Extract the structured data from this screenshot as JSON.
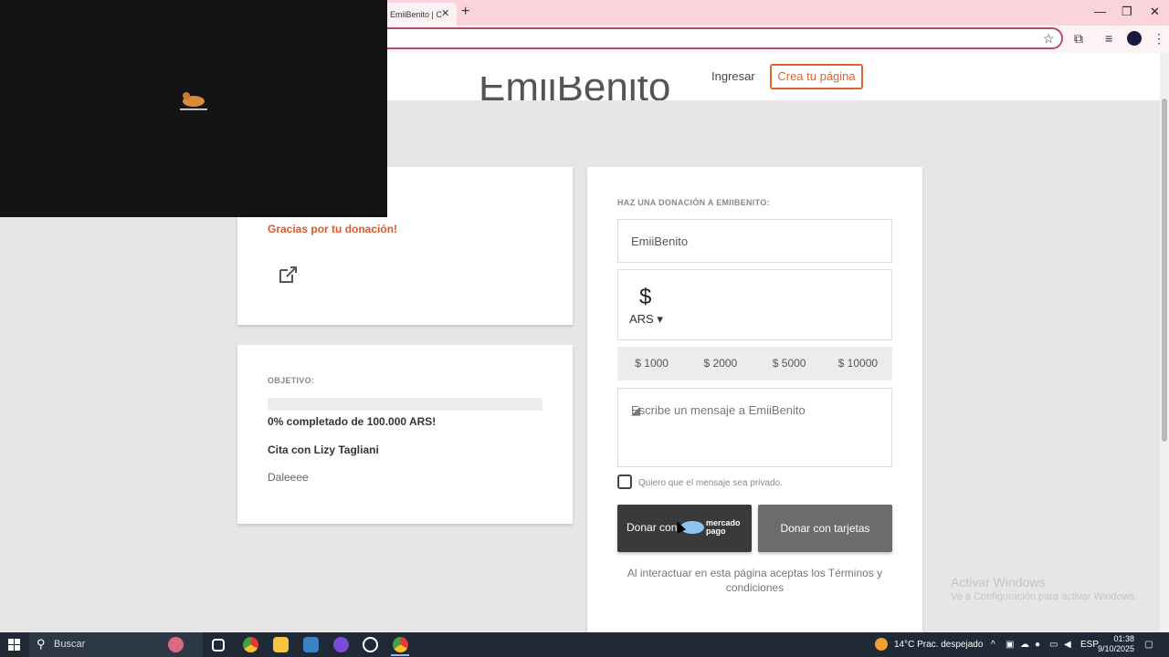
{
  "browser": {
    "tab_title": "EmiiBenito | C",
    "tab_close": "✕",
    "new_tab": "+",
    "window_controls": [
      "—",
      "❐",
      "✕"
    ],
    "toolbar_icons": [
      "star-icon",
      "extensions-icon",
      "media-icon",
      "profile-avatar",
      "menu-icon"
    ]
  },
  "page": {
    "nav": {
      "login": "Ingresar",
      "create": "Crea tu página"
    },
    "title": "EmiiBenito",
    "donation_card": {
      "thanks": "Gracias por tu donación!"
    },
    "goal": {
      "label": "OBJETIVO:",
      "progress_percent": 0,
      "progress_text": "0% completado de 100.000 ARS!",
      "title": "Cita con Lizy Tagliani",
      "description": "Daleeee"
    },
    "donate_form": {
      "heading": "HAZ UNA DONACIÓN A EMIIBENITO:",
      "name_value": "EmiiBenito",
      "currency_symbol": "$",
      "currency": "ARS",
      "presets": [
        "$ 1000",
        "$ 2000",
        "$ 5000",
        "$ 10000"
      ],
      "message_placeholder": "Escribe un mensaje a EmiiBenito",
      "private_label": "Quiero que el mensaje sea privado.",
      "mp_button": "Donar con",
      "mp_logo_text": "mercado pago",
      "cards_button": "Donar con tarjetas",
      "terms": "Al interactuar en esta página aceptas los Términos y condiciones"
    },
    "accent_color": "#e0622e"
  },
  "watermark": {
    "line1": "Activar Windows",
    "line2": "Ve a Configuración para activar Windows."
  },
  "taskbar": {
    "search": "Buscar",
    "weather": "14°C  Prac. despejado",
    "lang": "ESP",
    "time": "01:38",
    "date": "9/10/2025"
  }
}
